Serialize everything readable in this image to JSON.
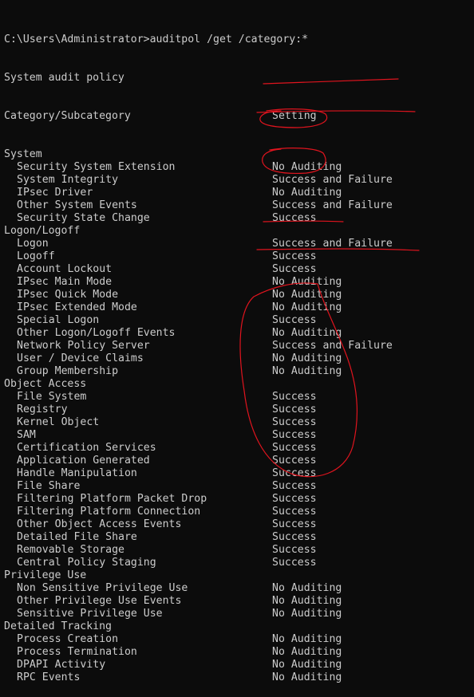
{
  "command": "C:\\Users\\Administrator>auditpol /get /category:*",
  "title": "System audit policy",
  "header": {
    "col1": "Category/Subcategory",
    "col2": "Setting"
  },
  "categories": [
    {
      "name": "System",
      "items": [
        {
          "name": "Security System Extension",
          "setting": "No Auditing"
        },
        {
          "name": "System Integrity",
          "setting": "Success and Failure"
        },
        {
          "name": "IPsec Driver",
          "setting": "No Auditing"
        },
        {
          "name": "Other System Events",
          "setting": "Success and Failure"
        },
        {
          "name": "Security State Change",
          "setting": "Success"
        }
      ]
    },
    {
      "name": "Logon/Logoff",
      "items": [
        {
          "name": "Logon",
          "setting": "Success and Failure"
        },
        {
          "name": "Logoff",
          "setting": "Success"
        },
        {
          "name": "Account Lockout",
          "setting": "Success"
        },
        {
          "name": "IPsec Main Mode",
          "setting": "No Auditing"
        },
        {
          "name": "IPsec Quick Mode",
          "setting": "No Auditing"
        },
        {
          "name": "IPsec Extended Mode",
          "setting": "No Auditing"
        },
        {
          "name": "Special Logon",
          "setting": "Success"
        },
        {
          "name": "Other Logon/Logoff Events",
          "setting": "No Auditing"
        },
        {
          "name": "Network Policy Server",
          "setting": "Success and Failure"
        },
        {
          "name": "User / Device Claims",
          "setting": "No Auditing"
        },
        {
          "name": "Group Membership",
          "setting": "No Auditing"
        }
      ]
    },
    {
      "name": "Object Access",
      "items": [
        {
          "name": "File System",
          "setting": "Success"
        },
        {
          "name": "Registry",
          "setting": "Success"
        },
        {
          "name": "Kernel Object",
          "setting": "Success"
        },
        {
          "name": "SAM",
          "setting": "Success"
        },
        {
          "name": "Certification Services",
          "setting": "Success"
        },
        {
          "name": "Application Generated",
          "setting": "Success"
        },
        {
          "name": "Handle Manipulation",
          "setting": "Success"
        },
        {
          "name": "File Share",
          "setting": "Success"
        },
        {
          "name": "Filtering Platform Packet Drop",
          "setting": "Success"
        },
        {
          "name": "Filtering Platform Connection",
          "setting": "Success"
        },
        {
          "name": "Other Object Access Events",
          "setting": "Success"
        },
        {
          "name": "Detailed File Share",
          "setting": "Success"
        },
        {
          "name": "Removable Storage",
          "setting": "Success"
        },
        {
          "name": "Central Policy Staging",
          "setting": "Success"
        }
      ]
    },
    {
      "name": "Privilege Use",
      "items": [
        {
          "name": "Non Sensitive Privilege Use",
          "setting": "No Auditing"
        },
        {
          "name": "Other Privilege Use Events",
          "setting": "No Auditing"
        },
        {
          "name": "Sensitive Privilege Use",
          "setting": "No Auditing"
        }
      ]
    },
    {
      "name": "Detailed Tracking",
      "items": [
        {
          "name": "Process Creation",
          "setting": "No Auditing"
        },
        {
          "name": "Process Termination",
          "setting": "No Auditing"
        },
        {
          "name": "DPAPI Activity",
          "setting": "No Auditing"
        },
        {
          "name": "RPC Events",
          "setting": "No Auditing"
        }
      ]
    }
  ],
  "colors": {
    "background": "#0c0c0c",
    "text": "#cccccc",
    "annotation": "#e0141e"
  }
}
